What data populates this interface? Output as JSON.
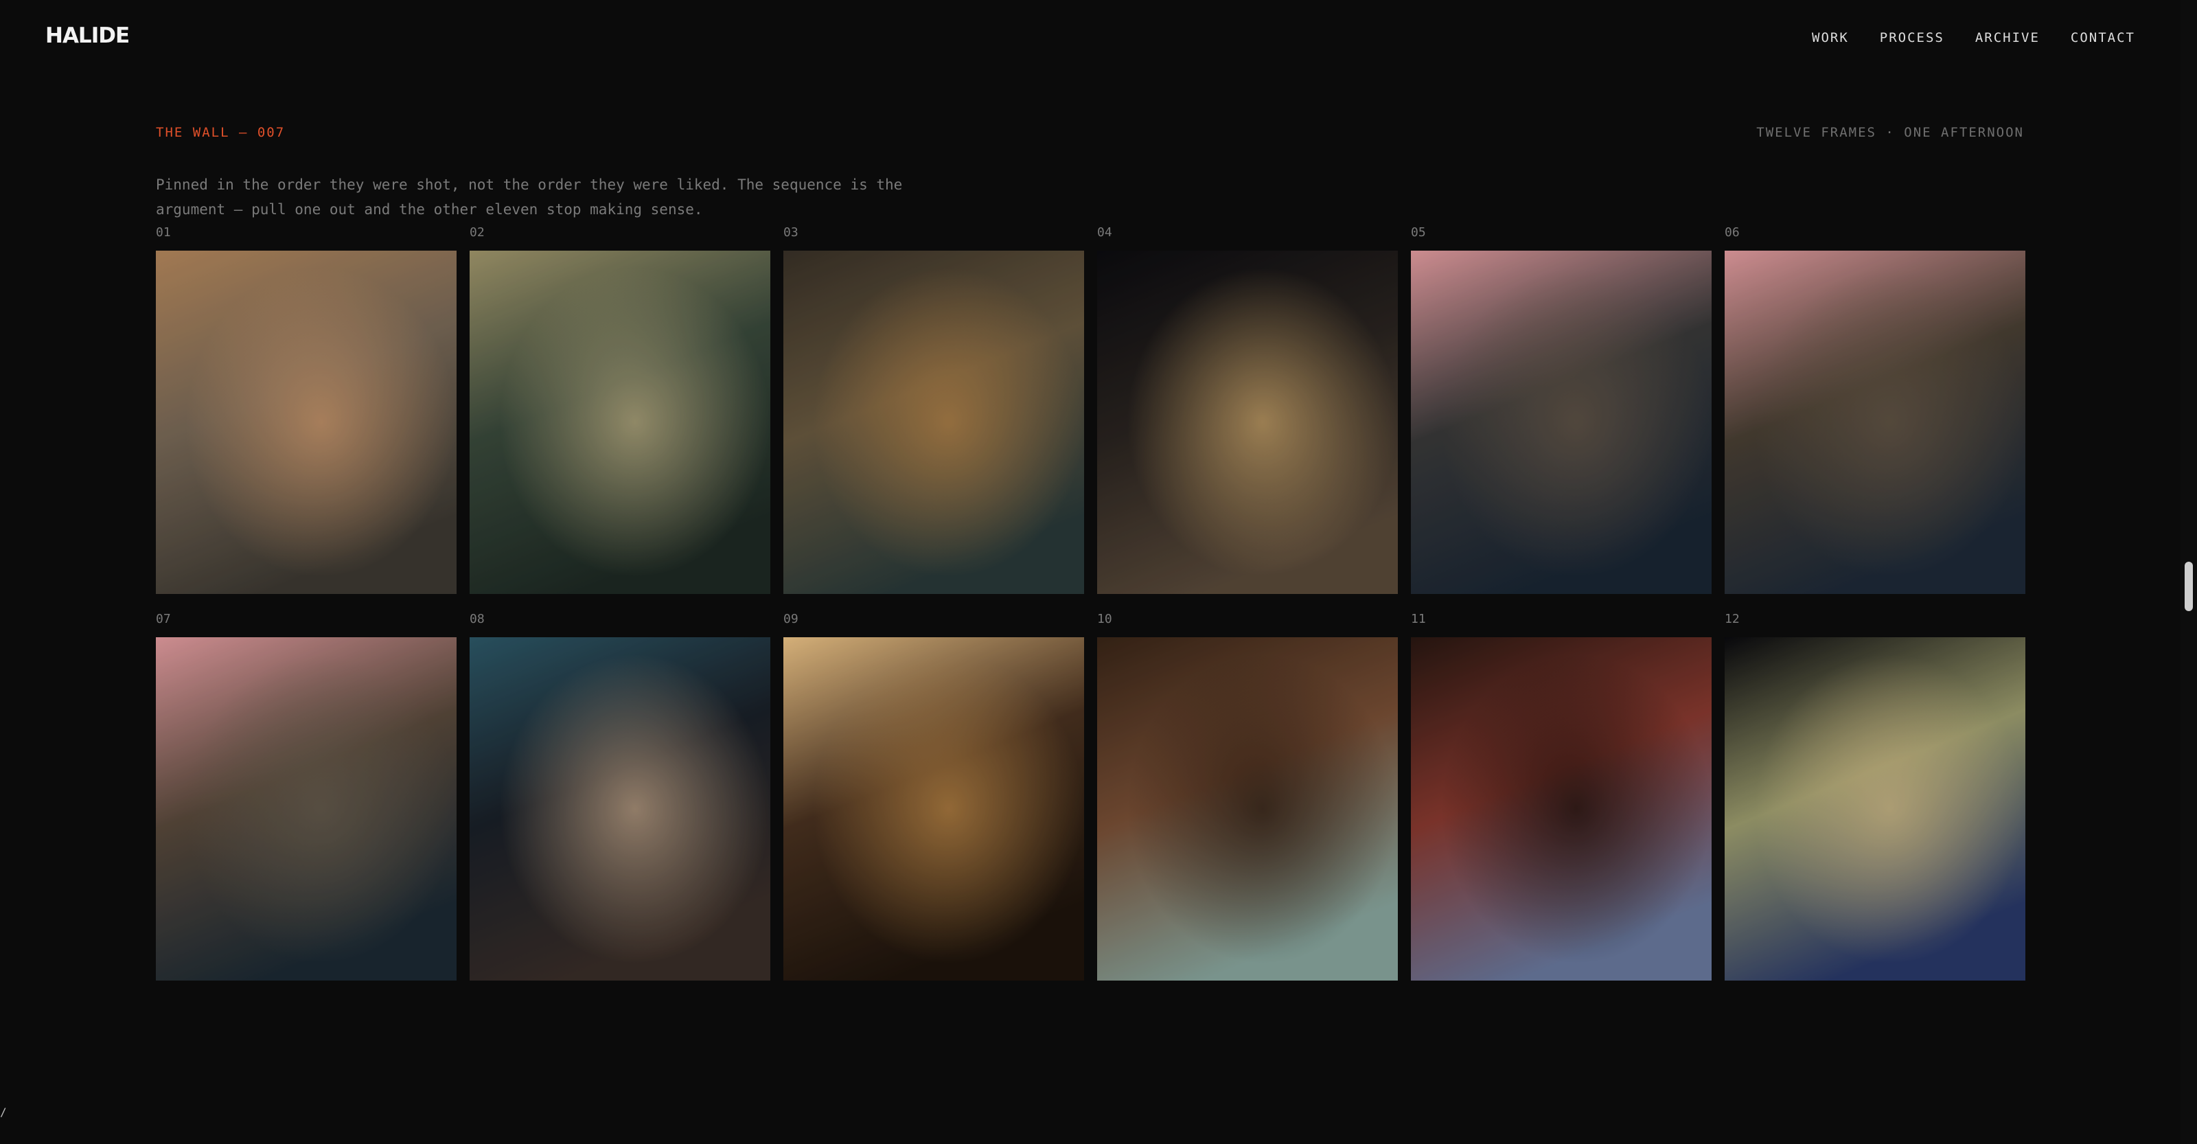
{
  "header": {
    "logo": "HALIDE",
    "nav": [
      "WORK",
      "PROCESS",
      "ARCHIVE",
      "CONTACT"
    ]
  },
  "section": {
    "eyebrow": "THE WALL — 007",
    "tagline": "TWELVE FRAMES · ONE AFTERNOON",
    "intro": "Pinned in the order they were shot, not the order they were liked. The sequence is the argument — pull one out and the other eleven stop making sense."
  },
  "frames": [
    {
      "num": "01",
      "colors": [
        "#b88a5e",
        "#7a6a58",
        "#3e3a33",
        "#d9a070"
      ]
    },
    {
      "num": "02",
      "colors": [
        "#a59a6e",
        "#3a4a3c",
        "#1e2a24",
        "#c9b98a"
      ]
    },
    {
      "num": "03",
      "colors": [
        "#3a3228",
        "#6a5a40",
        "#2a3a3a",
        "#c08a4a"
      ]
    },
    {
      "num": "04",
      "colors": [
        "#0c0c10",
        "#2a2420",
        "#5a4a3a",
        "#d9b070"
      ]
    },
    {
      "num": "05",
      "colors": [
        "#e9a0a4",
        "#3a3a3a",
        "#1a2634",
        "#6a5a4a"
      ]
    },
    {
      "num": "06",
      "colors": [
        "#e9a0a4",
        "#4a4034",
        "#1e2a38",
        "#6a5a48"
      ]
    },
    {
      "num": "07",
      "colors": [
        "#e9a0a4",
        "#5a4a3c",
        "#1c2a34",
        "#6a6050"
      ]
    },
    {
      "num": "08",
      "colors": [
        "#2e5a6a",
        "#1a2028",
        "#3a2e28",
        "#d0b090"
      ]
    },
    {
      "num": "09",
      "colors": [
        "#f2c88a",
        "#4a3220",
        "#1e140c",
        "#c8904a"
      ]
    },
    {
      "num": "10",
      "colors": [
        "#3a2618",
        "#7a5036",
        "#8aa8a0",
        "#2a1a10"
      ]
    },
    {
      "num": "11",
      "colors": [
        "#2a1812",
        "#8a3a30",
        "#6a7aa0",
        "#1a0e0a"
      ]
    },
    {
      "num": "12",
      "colors": [
        "#0a0a0e",
        "#a0a070",
        "#2a3a6a",
        "#d8c08a"
      ]
    }
  ],
  "scrollbar": {
    "position": 0.49
  },
  "footer": {
    "corner_mark": "/"
  }
}
